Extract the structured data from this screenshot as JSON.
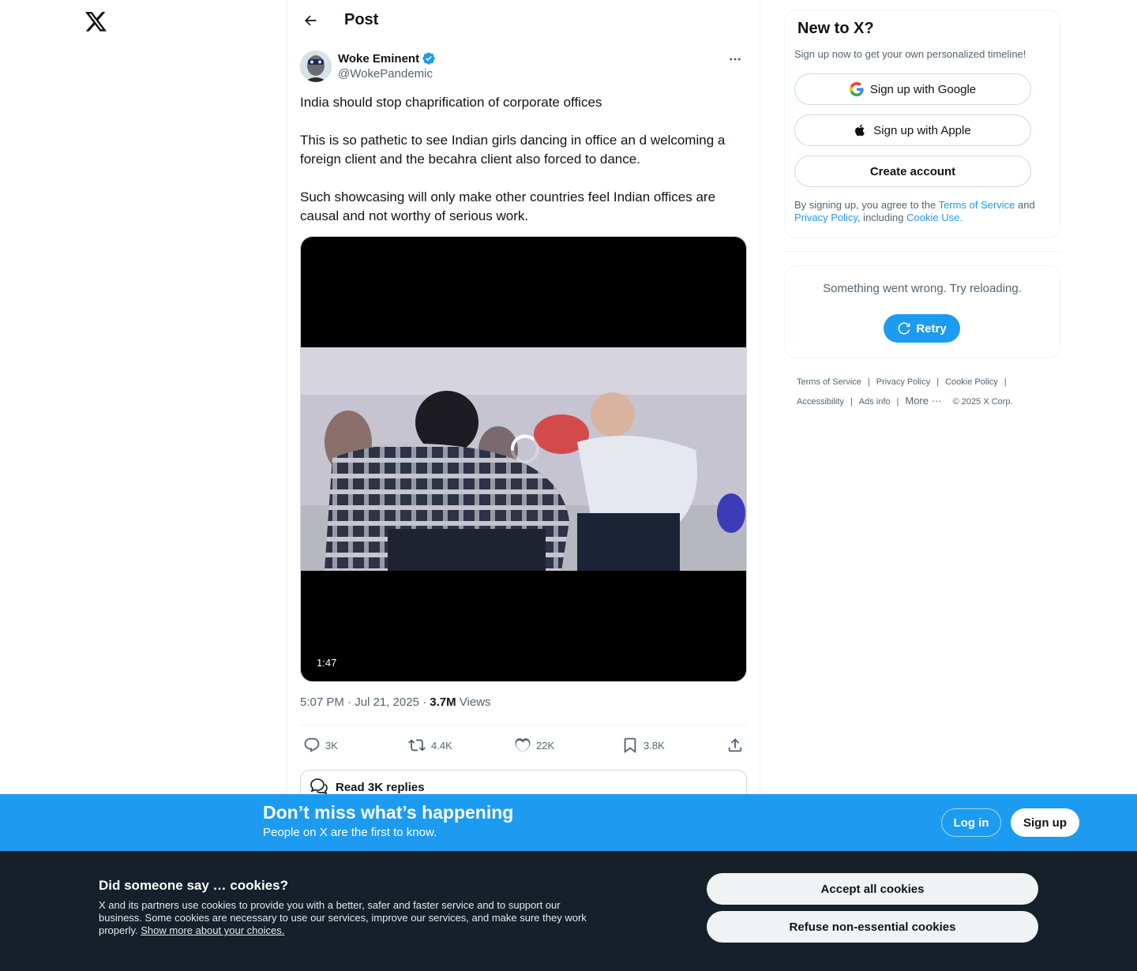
{
  "header": {
    "title": "Post"
  },
  "post": {
    "author_name": "Woke Eminent",
    "author_handle": "@WokePandemic",
    "paragraphs": [
      "India should stop chaprification of corporate offices",
      "This is so pathetic to see Indian girls dancing in office an d welcoming a foreign client and the becahra client also forced to dance.",
      "Such showcasing will only make other countries feel Indian offices are causal and not worthy of serious work."
    ],
    "video_duration": "1:47",
    "timestamp": "5:07 PM · Jul 21, 2025 · ",
    "views_count": "3.7M",
    "views_label": " Views",
    "replies": "3K",
    "reposts": "4.4K",
    "likes": "22K",
    "bookmarks": "3.8K",
    "read_replies": "Read 3K replies"
  },
  "sidebar": {
    "new_title": "New to X?",
    "new_sub": "Sign up now to get your own personalized timeline!",
    "google_btn": "Sign up with Google",
    "apple_btn": "Sign up with Apple",
    "create_btn": "Create account",
    "legal_prefix": "By signing up, you agree to the ",
    "legal_tos": "Terms of Service",
    "legal_and": " and ",
    "legal_privacy": "Privacy Policy",
    "legal_including": ", including ",
    "legal_cookie": "Cookie Use.",
    "error_text": "Something went wrong. Try reloading.",
    "retry": "Retry",
    "footer": {
      "tos": "Terms of Service",
      "privacy": "Privacy Policy",
      "cookie": "Cookie Policy",
      "accessibility": "Accessibility",
      "ads": "Ads info",
      "more": "More",
      "copyright": "© 2025 X Corp."
    }
  },
  "bottom_bar": {
    "title": "Don’t miss what’s happening",
    "subtitle": "People on X are the first to know.",
    "login": "Log in",
    "signup": "Sign up"
  },
  "cookie_banner": {
    "title": "Did someone say … cookies?",
    "text": "X and its partners use cookies to provide you with a better, safer and faster service and to support our business. Some cookies are necessary to use our services, improve our services, and make sure they work properly. ",
    "link": "Show more about your choices.",
    "accept": "Accept all cookies",
    "refuse": "Refuse non-essential cookies"
  },
  "colors": {
    "accent": "#1d9bf0",
    "text": "#0f1419",
    "secondary": "#536471",
    "cookie_bg": "#15202b"
  },
  "icons": [
    "x-logo-icon",
    "back-arrow-icon",
    "verified-badge-icon",
    "more-icon",
    "reply-icon",
    "repost-icon",
    "like-icon",
    "bookmark-icon",
    "share-icon",
    "replies-bubble-icon",
    "google-icon",
    "apple-icon",
    "refresh-icon"
  ]
}
